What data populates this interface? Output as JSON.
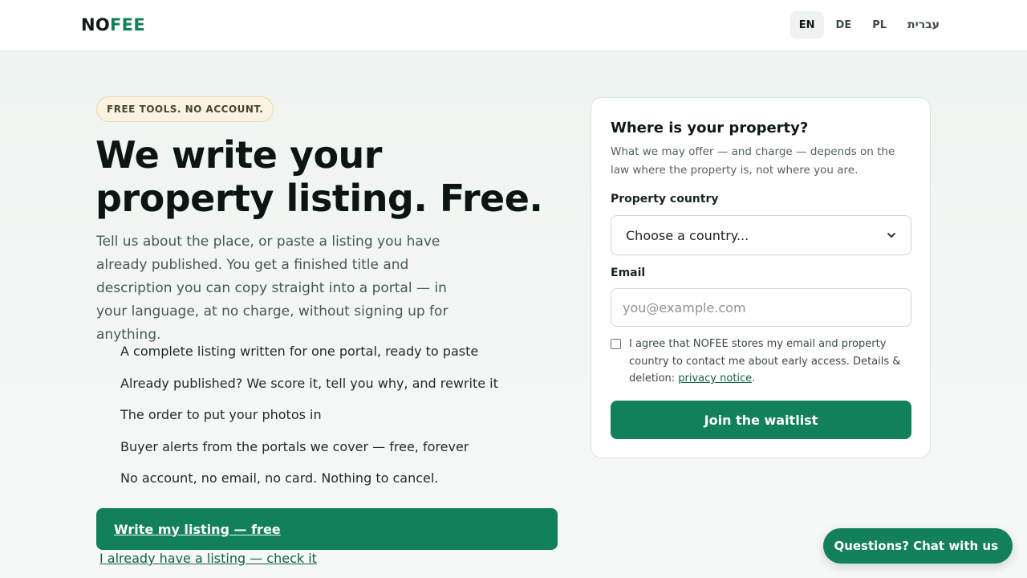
{
  "header": {
    "logo_prefix": "NO",
    "logo_suffix": "FEE",
    "languages": [
      {
        "label": "EN",
        "active": true
      },
      {
        "label": "DE",
        "active": false
      },
      {
        "label": "PL",
        "active": false
      },
      {
        "label": "עברית",
        "active": false
      }
    ]
  },
  "hero": {
    "badge": "FREE TOOLS. NO ACCOUNT.",
    "title": "We write your property listing. Free.",
    "description": "Tell us about the place, or paste a listing you have already published. You get a finished title and description you can copy straight into a portal — in your language, at no charge, without signing up for anything.",
    "features": [
      "A complete listing written for one portal, ready to paste",
      "Already published? We score it, tell you why, and rewrite it",
      "The order to put your photos in",
      "Buyer alerts from the portals we cover — free, forever",
      "No account, no email, no card. Nothing to cancel."
    ],
    "cta_label": "Write my listing — free",
    "secondary_link": "I already have a listing — check it"
  },
  "form": {
    "title": "Where is your property?",
    "subtitle": "What we may offer — and charge — depends on the law where the property is, not where you are.",
    "country_label": "Property country",
    "country_value": "Choose a country...",
    "email_label": "Email",
    "email_placeholder": "you@example.com",
    "consent_text": "I agree that NOFEE stores my email and property country to contact me about early access. Details & deletion: ",
    "consent_link": "privacy notice",
    "consent_end": ".",
    "submit_label": "Join the waitlist"
  },
  "chat": {
    "label": "Questions? Chat with us"
  },
  "colors": {
    "brand": "#12805a",
    "badge_bg": "#fbf3e1"
  }
}
